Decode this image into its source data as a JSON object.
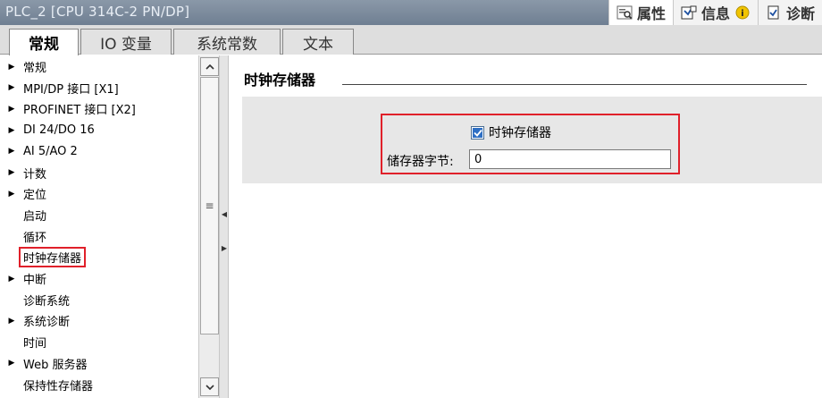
{
  "window": {
    "title": "PLC_2 [CPU 314C-2 PN/DP]"
  },
  "inspector_tabs": [
    {
      "label": "属性",
      "icon": "properties-icon"
    },
    {
      "label": "信息",
      "icon": "info-icon"
    },
    {
      "label": "诊断",
      "icon": "diagnostics-icon"
    }
  ],
  "tabs": [
    {
      "label": "常规"
    },
    {
      "label": "IO 变量"
    },
    {
      "label": "系统常数"
    },
    {
      "label": "文本"
    }
  ],
  "tree": {
    "items": [
      {
        "label": "常规",
        "expandable": true
      },
      {
        "label": "MPI/DP 接口 [X1]",
        "expandable": true
      },
      {
        "label": "PROFINET 接口 [X2]",
        "expandable": true
      },
      {
        "label": "DI 24/DO 16",
        "expandable": true
      },
      {
        "label": "AI 5/AO 2",
        "expandable": true
      },
      {
        "label": "计数",
        "expandable": true
      },
      {
        "label": "定位",
        "expandable": true
      },
      {
        "label": "启动",
        "expandable": false
      },
      {
        "label": "循环",
        "expandable": false
      },
      {
        "label": "时钟存储器",
        "expandable": false,
        "selected": true
      },
      {
        "label": "中断",
        "expandable": true
      },
      {
        "label": "诊断系统",
        "expandable": false
      },
      {
        "label": "系统诊断",
        "expandable": true
      },
      {
        "label": "时间",
        "expandable": false
      },
      {
        "label": "Web 服务器",
        "expandable": true
      },
      {
        "label": "保持性存储器",
        "expandable": false
      }
    ]
  },
  "content": {
    "section_title": "时钟存储器",
    "checkbox_label": "时钟存储器",
    "checkbox_checked": true,
    "field_label": "储存器字节:",
    "field_value": "0"
  },
  "colors": {
    "highlight": "#e0202a",
    "titlebar": "#7a899b"
  }
}
